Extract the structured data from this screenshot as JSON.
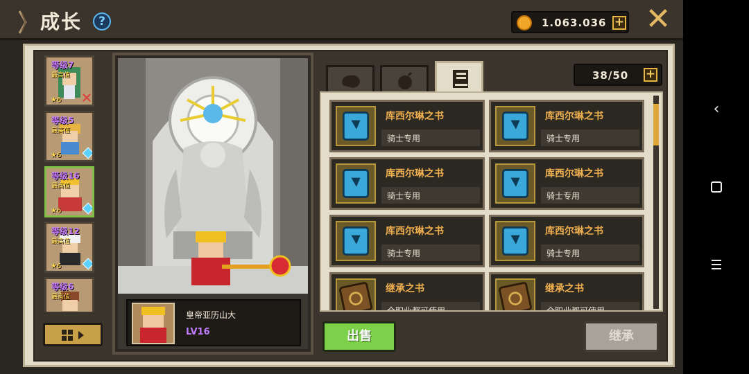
{
  "header": {
    "title": "成长",
    "help_label": "?",
    "gold": "1.063.036",
    "plus_label": "+",
    "close_label": "✕"
  },
  "heroes": [
    {
      "level": "等级7",
      "max": "最高值",
      "stars": "★6"
    },
    {
      "level": "等级5",
      "max": "最高值",
      "stars": "★6"
    },
    {
      "level": "等级16",
      "max": "最高值",
      "stars": "★6"
    },
    {
      "level": "等级12",
      "max": "最高值",
      "stars": "★6"
    },
    {
      "level": "等级6",
      "max": "最高值",
      "stars": ""
    }
  ],
  "selected_hero": {
    "name": "皇帝亚历山大",
    "level": "LV16"
  },
  "tabs": [
    {
      "icon": "bread-icon"
    },
    {
      "icon": "bomb-icon"
    },
    {
      "icon": "book-icon",
      "active": true
    }
  ],
  "inventory": {
    "capacity": "38/50",
    "scroll_position": 0.05,
    "items": [
      {
        "name": "库西尔琳之书",
        "desc": "骑士专用",
        "icon": "blue-book-icon"
      },
      {
        "name": "库西尔琳之书",
        "desc": "骑士专用",
        "icon": "blue-book-icon"
      },
      {
        "name": "库西尔琳之书",
        "desc": "骑士专用",
        "icon": "blue-book-icon"
      },
      {
        "name": "库西尔琳之书",
        "desc": "骑士专用",
        "icon": "blue-book-icon"
      },
      {
        "name": "库西尔琳之书",
        "desc": "骑士专用",
        "icon": "blue-book-icon"
      },
      {
        "name": "库西尔琳之书",
        "desc": "骑士专用",
        "icon": "blue-book-icon"
      },
      {
        "name": "继承之书",
        "desc": "全职业都可使用",
        "icon": "brown-book-icon"
      },
      {
        "name": "继承之书",
        "desc": "全职业都可使用",
        "icon": "brown-book-icon"
      }
    ]
  },
  "actions": {
    "sell": "出售",
    "inherit": "继承"
  },
  "colors": {
    "accent_gold": "#e3b864",
    "sell_green": "#7dd04a",
    "level_purple": "#c07cff",
    "item_name": "#f0b050"
  }
}
